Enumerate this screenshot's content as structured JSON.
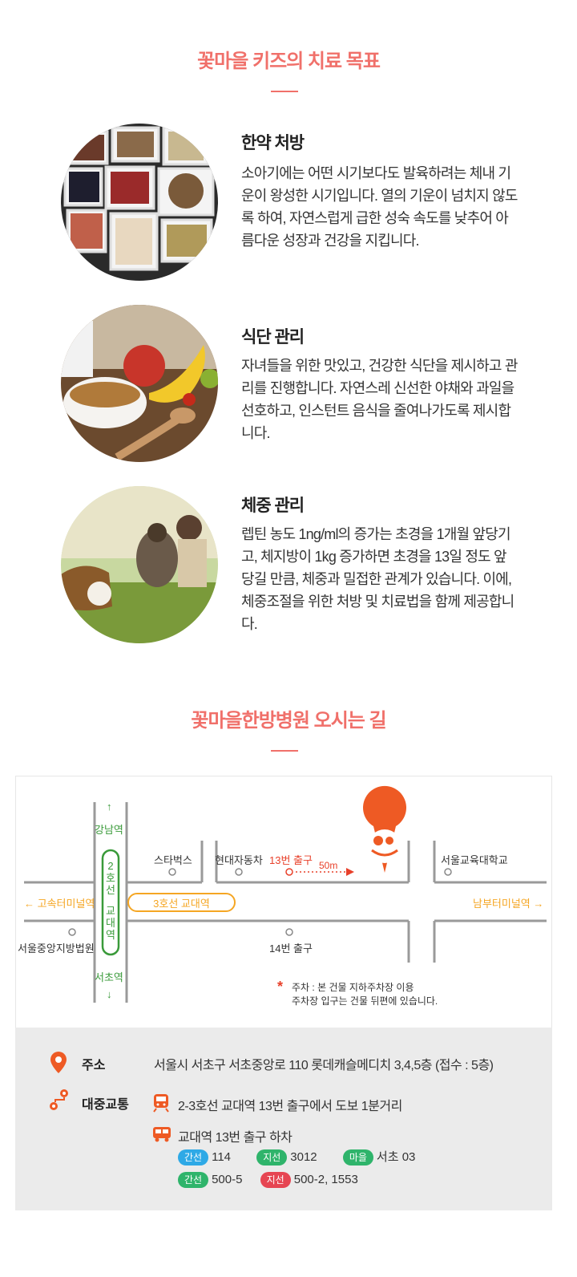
{
  "section1": {
    "title": "꽃마을 키즈의 치료 목표"
  },
  "items": [
    {
      "title": "한약 처방",
      "desc": "소아기에는 어떤 시기보다도 발육하려는 체내 기운이 왕성한 시기입니다. 열의 기운이 넘치지 않도록 하여, 자연스럽게 급한 성숙 속도를 낮추어 아름다운 성장과 건강을 지킵니다."
    },
    {
      "title": "식단 관리",
      "desc": "자녀들을 위한 맛있고, 건강한 식단을 제시하고 관리를 진행합니다. 자연스레 신선한 야채와 과일을 선호하고, 인스턴트 음식을 줄여나가도록 제시합니다."
    },
    {
      "title": "체중 관리",
      "desc": "렙틴 농도 1ng/ml의 증가는 초경을 1개월 앞당기고, 체지방이 1kg 증가하면 초경을 13일 정도 앞당길 만큼, 체중과 밀접한 관계가 있습니다. 이에, 체중조절을 위한 처방 및 치료법을 함께 제공합니다."
    }
  ],
  "section2": {
    "title": "꽃마을한방병원 오시는 길"
  },
  "map": {
    "gangnam": "강남역",
    "seocho": "서초역",
    "line2": "2호선",
    "gyodae": "교대역",
    "starbucks": "스타벅스",
    "hyundai": "현대자동차",
    "exit13": "13번 출구",
    "dist": "50m",
    "univ": "서울교육대학교",
    "express": "← 고속터미널역",
    "line3": "3호선 교대역",
    "nambu": "남부터미널역 →",
    "court": "서울중앙지방법원",
    "exit14": "14번 출구",
    "park1": "주차 : 본 건물 지하주차장 이용",
    "park2": "주차장 입구는 건물 뒤편에 있습니다.",
    "up": "↑",
    "down": "↓"
  },
  "info": {
    "addr_label": "주소",
    "addr": "서울시 서초구 서초중앙로 110 롯데캐슬메디치 3,4,5층 (접수 : 5층)",
    "trans_label": "대중교통",
    "subway": "2-3호선 교대역 13번 출구에서 도보 1분거리",
    "bus": "교대역 13번 출구 하차",
    "buses": [
      {
        "type": "간선",
        "num": "114",
        "color": "#2ea9e6"
      },
      {
        "type": "지선",
        "num": "3012",
        "color": "#2fb46b"
      },
      {
        "type": "마을",
        "num": "서초 03",
        "color": "#2fb46b"
      },
      {
        "type": "간선",
        "num": "500-5",
        "color": "#2fb46b"
      },
      {
        "type": "지선",
        "num": "500-2, 1553",
        "color": "#e64552"
      }
    ]
  }
}
